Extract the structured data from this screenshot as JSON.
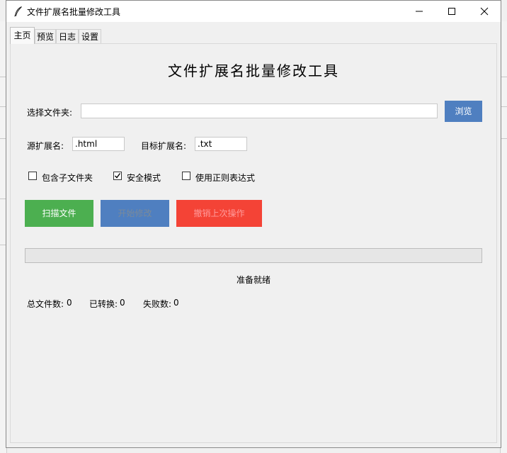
{
  "window": {
    "title": "文件扩展名批量修改工具"
  },
  "tabs": [
    {
      "label": "主页",
      "active": true
    },
    {
      "label": "预览",
      "active": false
    },
    {
      "label": "日志",
      "active": false
    },
    {
      "label": "设置",
      "active": false
    }
  ],
  "main": {
    "heading": "文件扩展名批量修改工具",
    "folder": {
      "label": "选择文件夹:",
      "value": "",
      "browse_label": "浏览"
    },
    "source_ext": {
      "label": "源扩展名:",
      "value": ".html"
    },
    "target_ext": {
      "label": "目标扩展名:",
      "value": ".txt"
    },
    "options": [
      {
        "label": "包含子文件夹",
        "checked": false
      },
      {
        "label": "安全模式",
        "checked": true
      },
      {
        "label": "使用正则表达式",
        "checked": false
      }
    ],
    "buttons": {
      "scan": {
        "label": "扫描文件",
        "color": "#4caf50"
      },
      "start": {
        "label": "开始修改",
        "color": "#4f7fc0",
        "enabled": false
      },
      "undo": {
        "label": "撤销上次操作",
        "color": "#f44336",
        "enabled": false
      }
    },
    "progress": {
      "value": 0
    },
    "status": "准备就绪",
    "stats": {
      "total_label": "总文件数:",
      "total": "0",
      "converted_label": "已转换:",
      "converted": "0",
      "failed_label": "失败数:",
      "failed": "0"
    }
  },
  "colors": {
    "browse": "#4f7fc0",
    "disabled_text": "#7a8a9a"
  }
}
